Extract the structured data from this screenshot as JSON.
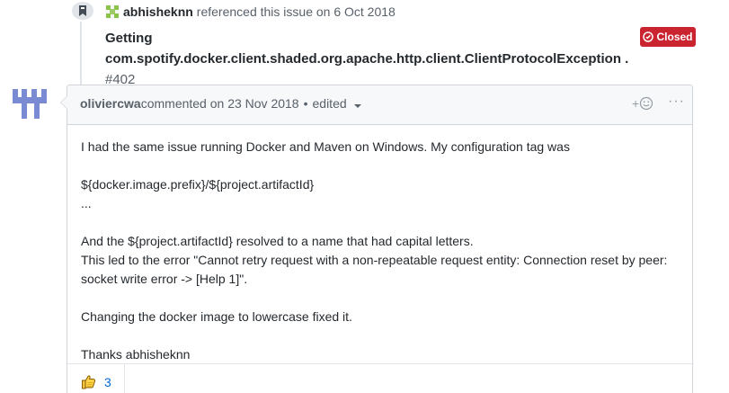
{
  "reference_event": {
    "actor": "abhisheknn",
    "action_text": "referenced this issue on 6 Oct 2018",
    "issue_title": "Getting com.spotify.docker.client.shaded.org.apache.http.client.ClientProtocolException .",
    "issue_number": "#402",
    "state_label": "Closed"
  },
  "comment": {
    "author": "oliviercwa",
    "meta_text": "commented on 23 Nov 2018",
    "separator": "•",
    "edited_label": "edited",
    "reaction_plus": "+",
    "more_label": "···",
    "body": {
      "p1": "I had the same issue running Docker and Maven on Windows. My configuration tag was",
      "p2": "${docker.image.prefix}/${project.artifactId}",
      "p3": "...",
      "p4": "And the ${project.artifactId} resolved to a name that had capital letters.",
      "p5": "This led to the error \"Cannot retry request with a non-repeatable request entity: Connection reset by peer:",
      "p6": "socket write error -> [Help 1]\".",
      "p7": "Changing the docker image to lowercase fixed it.",
      "p8": "Thanks abhisheknn"
    },
    "reactions": [
      {
        "icon": "thumbs-up-icon",
        "count": "3"
      }
    ]
  },
  "colors": {
    "closed_red": "#cb2431",
    "link_blue": "#0366d6",
    "header_gray": "#f6f8fa",
    "border_gray": "#d1d5da",
    "avatar_purple": "#7b8bd3",
    "thumb_yellow": "#ffd24a"
  }
}
